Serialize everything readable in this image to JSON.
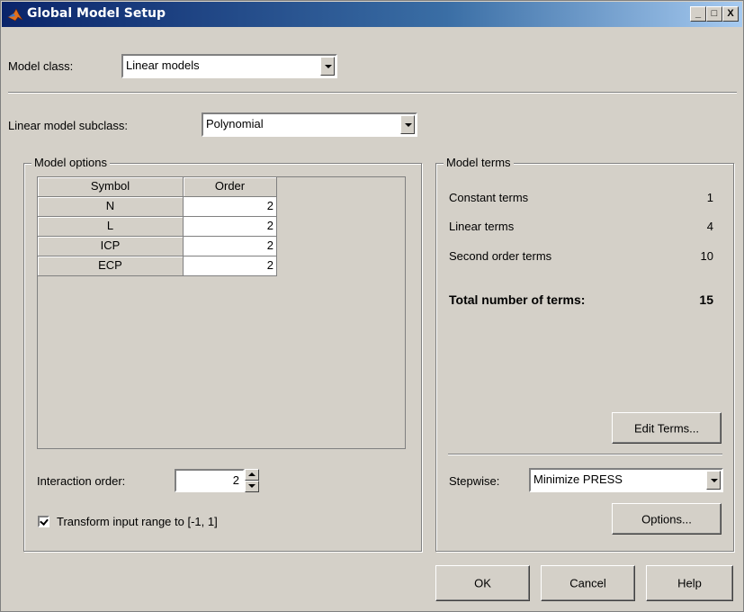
{
  "window": {
    "title": "Global Model Setup",
    "minimize": "_",
    "maximize": "□",
    "close": "X"
  },
  "model_class": {
    "label": "Model class:",
    "value": "Linear models"
  },
  "subclass": {
    "label": "Linear model subclass:",
    "value": "Polynomial"
  },
  "model_options": {
    "title": "Model options",
    "table": {
      "headers": [
        "Symbol",
        "Order"
      ],
      "rows": [
        {
          "symbol": "N",
          "order": "2"
        },
        {
          "symbol": "L",
          "order": "2"
        },
        {
          "symbol": "ICP",
          "order": "2"
        },
        {
          "symbol": "ECP",
          "order": "2"
        }
      ]
    },
    "interaction_label": "Interaction order:",
    "interaction_value": "2",
    "transform_label": "Transform input range to [-1, 1]",
    "transform_checked": true
  },
  "model_terms": {
    "title": "Model terms",
    "constant_label": "Constant terms",
    "constant_value": "1",
    "linear_label": "Linear terms",
    "linear_value": "4",
    "second_label": "Second order terms",
    "second_value": "10",
    "total_label": "Total number of terms:",
    "total_value": "15",
    "edit_button": "Edit Terms...",
    "stepwise_label": "Stepwise:",
    "stepwise_value": "Minimize PRESS",
    "options_button": "Options..."
  },
  "buttons": {
    "ok": "OK",
    "cancel": "Cancel",
    "help": "Help"
  }
}
